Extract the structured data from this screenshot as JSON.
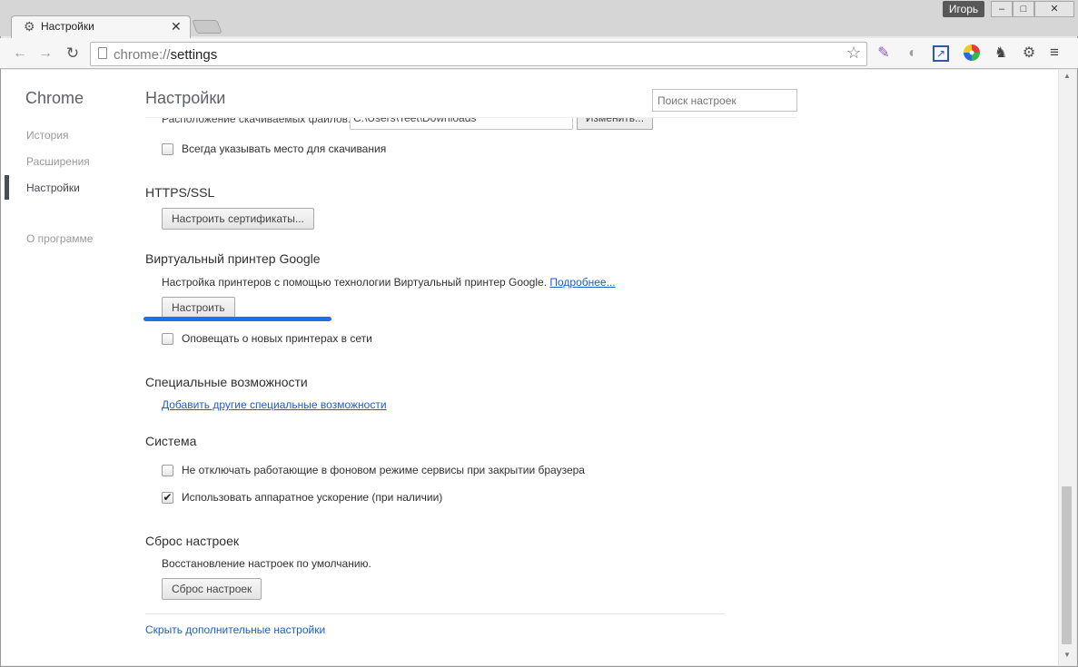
{
  "window": {
    "user_name": "Игорь",
    "minimize": "–",
    "maximize": "□",
    "close": "✕"
  },
  "tabs": [
    {
      "title": "Настройки",
      "icon": "gear-icon",
      "close": "✕"
    }
  ],
  "toolbar": {
    "back": "←",
    "forward": "→",
    "reload": "↻",
    "url_scheme": "chrome://",
    "url_rest": "settings",
    "star": "☆",
    "menu": "≡"
  },
  "extensions": [
    {
      "icon": "feather-icon",
      "glyph": "✎"
    },
    {
      "icon": "grey-circle-icon",
      "glyph": "◐"
    },
    {
      "icon": "blue-arrow-icon",
      "glyph": "↗"
    },
    {
      "icon": "color-wheel-icon",
      "glyph": "✺"
    },
    {
      "icon": "evernote-icon",
      "glyph": "♞"
    },
    {
      "icon": "gear-extension-icon",
      "glyph": "⚙"
    }
  ],
  "sidebar": {
    "brand": "Chrome",
    "items": [
      {
        "label": "История"
      },
      {
        "label": "Расширения"
      },
      {
        "label": "Настройки",
        "selected": true
      },
      {
        "label": "О программе"
      }
    ]
  },
  "header": {
    "title": "Настройки",
    "search_placeholder": "Поиск настроек"
  },
  "downloads": {
    "location_label": "Расположение скачиваемых файлов:",
    "location_value": "C:\\Users\\Teet\\Downloads",
    "change_button": "Изменить...",
    "ask_label": "Всегда указывать место для скачивания",
    "ask_checked": false
  },
  "https": {
    "title": "HTTPS/SSL",
    "manage_button": "Настроить сертификаты..."
  },
  "cloud_print": {
    "title": "Виртуальный принтер Google",
    "description": "Настройка принтеров с помощью технологии Виртуальный принтер Google.",
    "learn_more": "Подробнее...",
    "setup_button": "Настроить",
    "notify_label": "Оповещать о новых принтерах в сети",
    "notify_checked": false,
    "highlight_color": "#1a73e8"
  },
  "accessibility": {
    "title": "Специальные возможности",
    "add_link": "Добавить другие специальные возможности"
  },
  "system": {
    "title": "Система",
    "background_label": "Не отключать работающие в фоновом режиме сервисы при закрытии браузера",
    "background_checked": false,
    "hardware_label": "Использовать аппаратное ускорение (при наличии)",
    "hardware_checked": true
  },
  "reset": {
    "title": "Сброс настроек",
    "description": "Восстановление настроек по умолчанию.",
    "button": "Сброс настроек"
  },
  "footer": {
    "hide_advanced": "Скрыть дополнительные настройки"
  }
}
